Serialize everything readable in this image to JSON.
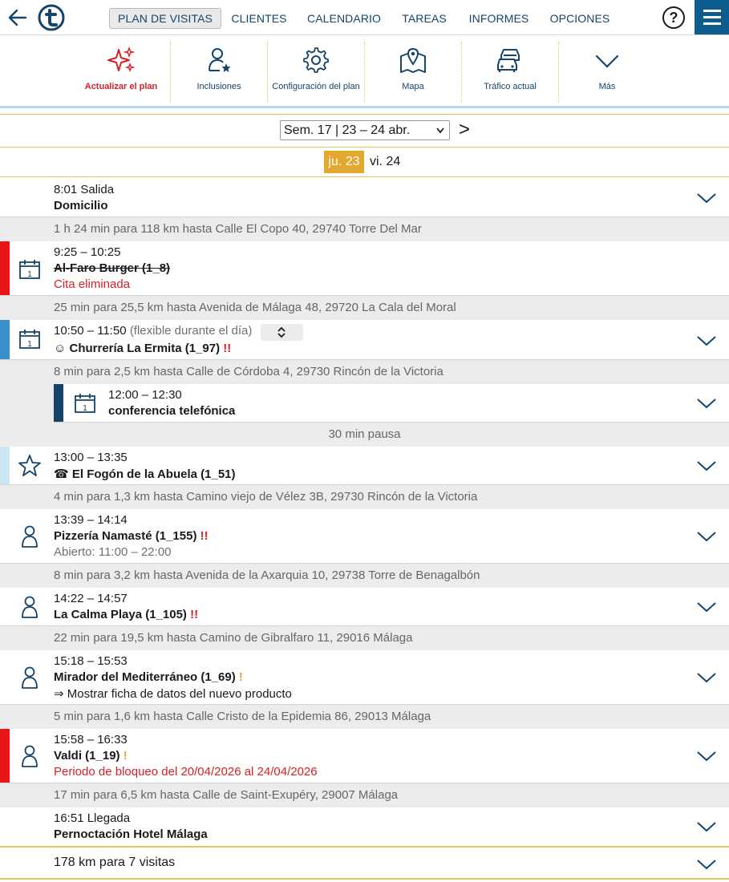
{
  "nav": {
    "tabs": [
      "PLAN DE VISITAS",
      "CLIENTES",
      "CALENDARIO",
      "TAREAS",
      "INFORMES",
      "OPCIONES"
    ],
    "active_tab": "PLAN DE VISITAS",
    "help": "?"
  },
  "toolbar": {
    "items": [
      {
        "label": "Actualizar el plan",
        "icon": "sparkle-icon"
      },
      {
        "label": "Inclusiones",
        "icon": "person-star-icon"
      },
      {
        "label": "Configuración del plan",
        "icon": "gear-icon"
      },
      {
        "label": "Mapa",
        "icon": "map-pin-icon"
      },
      {
        "label": "Tráfico actual",
        "icon": "traffic-cars-icon"
      },
      {
        "label": "Más",
        "icon": "chevron-down-icon"
      }
    ],
    "primary_color": "#d81f26",
    "accent_color": "#15446b"
  },
  "week": {
    "selected": "Sem. 17 | 23 – 24 abr.",
    "next": ">"
  },
  "days": {
    "active": "ju. 23",
    "other": "vi. 24",
    "active_color": "#e3a92f"
  },
  "schedule": {
    "start": {
      "time": "8:01 Salida",
      "place": "Domicilio"
    },
    "gap1": "1 h 24 min para 118 km hasta Calle El Copo 40, 29740 Torre Del Mar",
    "visit1": {
      "time": "9:25 – 10:25",
      "name": "Al-Faro Burger (1_8)",
      "note": "Cita eliminada",
      "bar_color": "#e8141a",
      "icon": "calendar-icon"
    },
    "gap2": "25 min para 25,5 km hasta Avenida de Málaga 48, 29720 La Cala del Moral",
    "visit2": {
      "time": "10:50 – 11:50",
      "time_note": "(flexible durante el día)",
      "prefix": "☺",
      "name": "Churrería La Ermita (1_97)",
      "warn": "!!",
      "bar_color": "#3b8fcb",
      "icon": "calendar-icon"
    },
    "gap3": "8 min para 2,5 km hasta Calle de Córdoba 4, 29730 Rincón de la Victoria",
    "meeting": {
      "time": "12:00 – 12:30",
      "name": "conferencia telefónica",
      "bar_color": "#15446b",
      "icon": "calendar-icon"
    },
    "pause": "30 min pausa",
    "visit3": {
      "time": "13:00 – 13:35",
      "prefix": "☎",
      "name": "El Fogón de la Abuela (1_51)",
      "bar_color": "#cde6f6",
      "icon": "star-icon"
    },
    "gap4": "4 min para 1,3 km hasta Camino viejo de Vélez 3B, 29730 Rincón de la Victoria",
    "visit4": {
      "time": "13:39 – 14:14",
      "name": "Pizzería Namasté (1_155)",
      "warn": "!!",
      "note": "Abierto: 11:00 – 22:00",
      "icon": "person-icon"
    },
    "gap5": "8 min para 3,2 km hasta Avenida de la Axarquia 10, 29738 Torre de Benagalbón",
    "visit5": {
      "time": "14:22 – 14:57",
      "name": "La Calma Playa (1_105)",
      "warn": "!!",
      "icon": "person-icon"
    },
    "gap6": "22 min para 19,5 km hasta Camino de Gibralfaro 11, 29016 Málaga",
    "visit6": {
      "time": "15:18 – 15:53",
      "name": "Mirador del Mediterráneo (1_69)",
      "warn": "!",
      "note": "⇒ Mostrar ficha de datos del nuevo producto",
      "icon": "person-icon"
    },
    "gap7": "5 min para 1,6 km hasta Calle Cristo de la Epidemia 86, 29013 Málaga",
    "visit7": {
      "time": "15:58 – 16:33",
      "name": "Valdi (1_19)",
      "warn": "!",
      "note": "Periodo de bloqueo del 20/04/2026 al 24/04/2026",
      "bar_color": "#e8141a",
      "icon": "person-icon"
    },
    "gap8": "17 min para 6,5 km hasta Calle de Saint-Exupéry, 29007 Málaga",
    "end": {
      "time": "16:51 Llegada",
      "place": "Pernoctación Hotel Málaga"
    },
    "summary": "178 km para 7 visitas"
  }
}
